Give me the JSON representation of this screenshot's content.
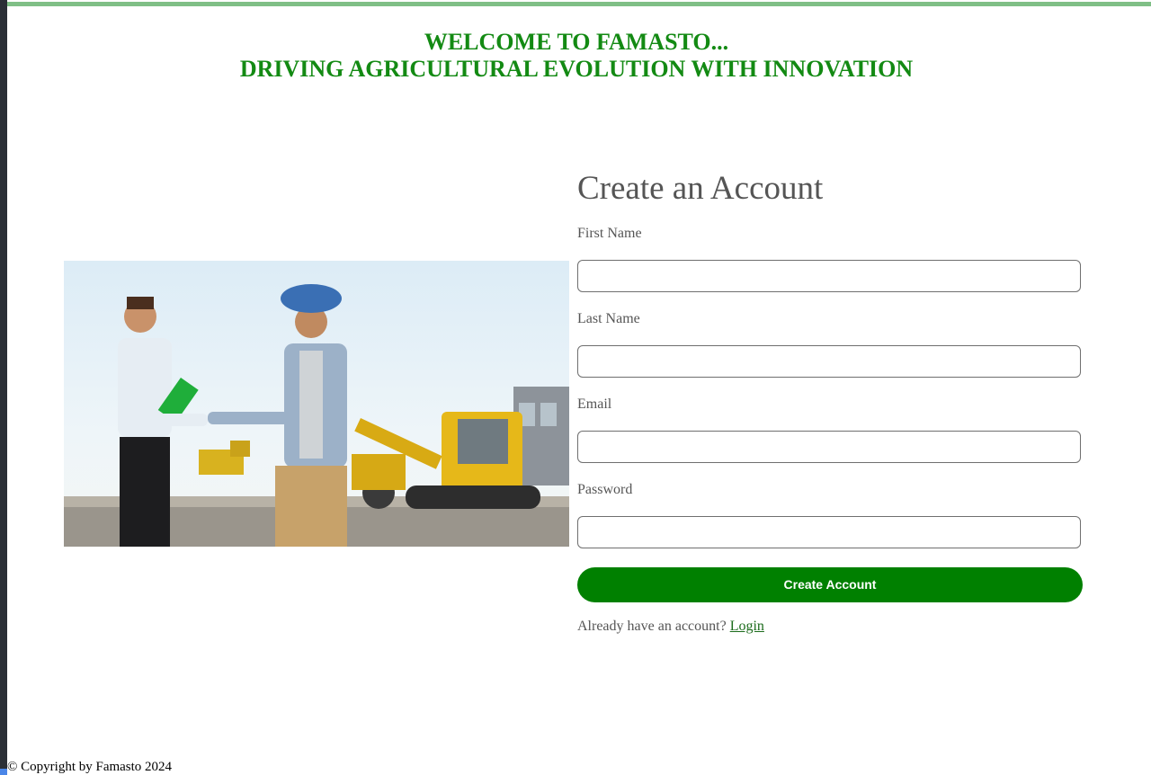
{
  "header": {
    "welcome": "WELCOME TO FAMASTO...",
    "tagline": "DRIVING AGRICULTURAL EVOLUTION WITH INNOVATION",
    "color": "#138a13"
  },
  "hero": {
    "image": "handshake-construction-site-photo"
  },
  "form": {
    "title": "Create an Account",
    "fields": [
      {
        "label": "First Name",
        "value": "",
        "placeholder": ""
      },
      {
        "label": "Last Name",
        "value": "",
        "placeholder": ""
      },
      {
        "label": "Email",
        "value": "",
        "placeholder": ""
      },
      {
        "label": "Password",
        "value": "",
        "placeholder": ""
      }
    ],
    "submit_label": "Create Account",
    "submit_color": "#008000",
    "login_prompt": "Already have an account?",
    "login_link": "Login"
  },
  "footer": {
    "copyright": "© Copyright by Famasto 2024"
  }
}
